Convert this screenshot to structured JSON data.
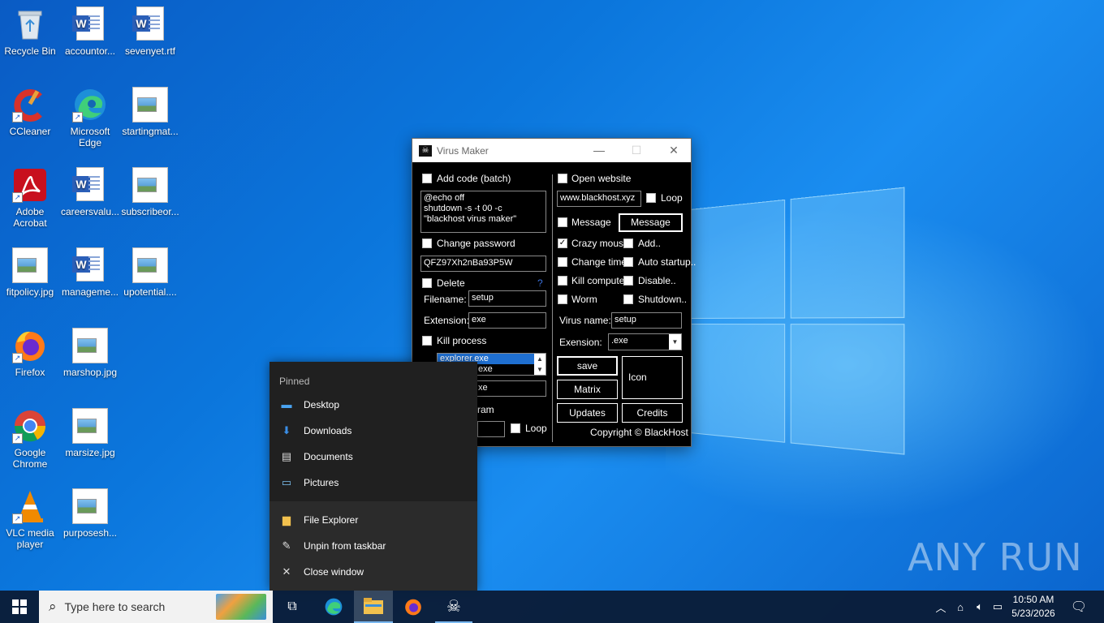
{
  "desktop_icons": [
    {
      "label": "Recycle Bin"
    },
    {
      "label": "accountor..."
    },
    {
      "label": "sevenyet.rtf"
    },
    {
      "label": "CCleaner"
    },
    {
      "label": "Microsoft Edge"
    },
    {
      "label": "startingmat..."
    },
    {
      "label": "Adobe Acrobat"
    },
    {
      "label": "careersvalu..."
    },
    {
      "label": "subscribeor..."
    },
    {
      "label": "fitpolicy.jpg"
    },
    {
      "label": "manageme..."
    },
    {
      "label": "upotential...."
    },
    {
      "label": "Firefox"
    },
    {
      "label": "marshop.jpg"
    },
    {
      "label": "Google Chrome"
    },
    {
      "label": "marsize.jpg"
    },
    {
      "label": "VLC media player"
    },
    {
      "label": "purposesh..."
    }
  ],
  "virus_maker": {
    "title": "Virus Maker",
    "add_code_label": "Add code (batch)",
    "code_text": "@echo off\nshutdown -s -t 00 -c \"blackhost virus maker\"",
    "change_password_label": "Change password",
    "password_value": "QFZ97Xh2nBa93P5W",
    "delete_label": "Delete",
    "help_mark": "?",
    "filename_label": "Filename:",
    "filename_value": "setup",
    "extension_label": "Extension:",
    "extension_value": "exe",
    "kill_process_label": "Kill process",
    "process_list": [
      "explorer.exe",
      "exe"
    ],
    "exe_field_value": "xe",
    "program_label_partial": "ram",
    "loop_label_left": "Loop",
    "open_website_label": "Open website",
    "website_value": "www.blackhost.xyz",
    "loop_label": "Loop",
    "message_label": "Message",
    "message_button": "Message",
    "crazy_mouse_label": "Crazy mouse",
    "add_label": "Add..",
    "change_time_label": "Change time",
    "auto_startup_label": "Auto startup..",
    "kill_computer_label": "Kill computer",
    "disable_label": "Disable..",
    "worm_label": "Worm",
    "shutdown_label": "Shutdown..",
    "virus_name_label": "Virus name:",
    "virus_name_value": "setup",
    "exension_label": "Exension:",
    "ext_select_value": ".exe",
    "save_button": "save",
    "icon_button": "Icon",
    "matrix_button": "Matrix",
    "updates_button": "Updates",
    "credits_button": "Credits",
    "copyright": "Copyright © BlackHost",
    "crazy_mouse_checked": true
  },
  "jump_list": {
    "section": "Pinned",
    "pinned": [
      "Desktop",
      "Downloads",
      "Documents",
      "Pictures"
    ],
    "actions": [
      "File Explorer",
      "Unpin from taskbar",
      "Close window"
    ]
  },
  "taskbar": {
    "search_placeholder": "Type here to search",
    "time": "10:50 AM",
    "date": "5/23/2026"
  },
  "watermark": "ANY RUN"
}
